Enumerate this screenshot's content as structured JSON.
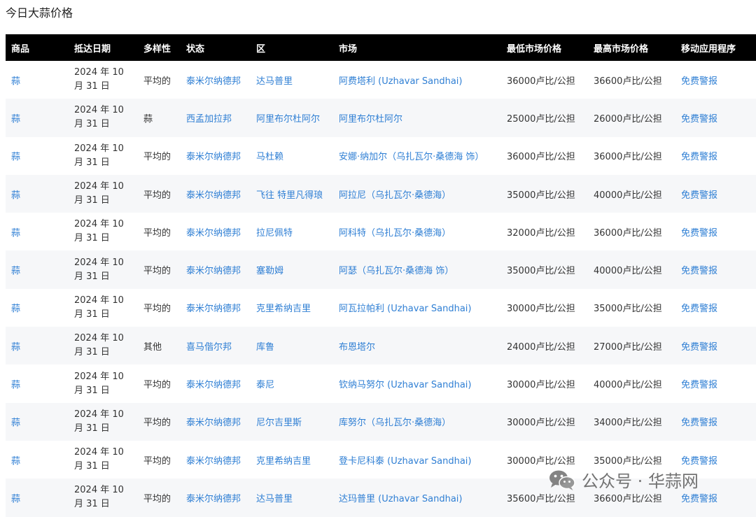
{
  "page": {
    "title": "今日大蒜价格"
  },
  "table": {
    "headers": [
      "商品",
      "抵达日期",
      "多样性",
      "状态",
      "区",
      "市场",
      "最低市场价格",
      "最高市场价格",
      "移动应用程序"
    ],
    "rows": [
      [
        "蒜",
        "2024 年 10 月 31 日",
        "平均的",
        "泰米尔纳德邦",
        "达马普里",
        "阿费塔利 (Uzhavar Sandhai)",
        "36000卢比/公担",
        "36600卢比/公担",
        "免费警报"
      ],
      [
        "蒜",
        "2024 年 10 月 31 日",
        "蒜",
        "西孟加拉邦",
        "阿里布尔杜阿尔",
        "阿里布尔杜阿尔",
        "25000卢比/公担",
        "26000卢比/公担",
        "免费警报"
      ],
      [
        "蒜",
        "2024 年 10 月 31 日",
        "平均的",
        "泰米尔纳德邦",
        "马杜赖",
        "安娜·纳加尔（乌扎瓦尔·桑德海 饰）",
        "36000卢比/公担",
        "36000卢比/公担",
        "免费警报"
      ],
      [
        "蒜",
        "2024 年 10 月 31 日",
        "平均的",
        "泰米尔纳德邦",
        "飞往 特里凡得琅",
        "阿拉尼（乌扎瓦尔·桑德海）",
        "35000卢比/公担",
        "40000卢比/公担",
        "免费警报"
      ],
      [
        "蒜",
        "2024 年 10 月 31 日",
        "平均的",
        "泰米尔纳德邦",
        "拉尼佩特",
        "阿科特（乌扎瓦尔·桑德海）",
        "32000卢比/公担",
        "36000卢比/公担",
        "免费警报"
      ],
      [
        "蒜",
        "2024 年 10 月 31 日",
        "平均的",
        "泰米尔纳德邦",
        "塞勒姆",
        "阿瑟（乌扎瓦尔·桑德海 饰）",
        "35000卢比/公担",
        "40000卢比/公担",
        "免费警报"
      ],
      [
        "蒜",
        "2024 年 10 月 31 日",
        "平均的",
        "泰米尔纳德邦",
        "克里希纳吉里",
        "阿瓦拉帕利 (Uzhavar Sandhai)",
        "30000卢比/公担",
        "35000卢比/公担",
        "免费警报"
      ],
      [
        "蒜",
        "2024 年 10 月 31 日",
        "其他",
        "喜马偕尔邦",
        "库鲁",
        "布恩塔尔",
        "24000卢比/公担",
        "27000卢比/公担",
        "免费警报"
      ],
      [
        "蒜",
        "2024 年 10 月 31 日",
        "平均的",
        "泰米尔纳德邦",
        "泰尼",
        "钦纳马努尔 (Uzhavar Sandhai)",
        "30000卢比/公担",
        "40000卢比/公担",
        "免费警报"
      ],
      [
        "蒜",
        "2024 年 10 月 31 日",
        "平均的",
        "泰米尔纳德邦",
        "尼尔吉里斯",
        "库努尔（乌扎瓦尔·桑德海）",
        "30000卢比/公担",
        "34000卢比/公担",
        "免费警报"
      ],
      [
        "蒜",
        "2024 年 10 月 31 日",
        "平均的",
        "泰米尔纳德邦",
        "克里希纳吉里",
        "登卡尼科泰 (Uzhavar Sandhai)",
        "30000卢比/公担",
        "35000卢比/公担",
        "免费警报"
      ],
      [
        "蒜",
        "2024 年 10 月 31 日",
        "平均的",
        "泰米尔纳德邦",
        "达马普里",
        "达玛普里 (Uzhavar Sandhai)",
        "35600卢比/公担",
        "36600卢比/公担",
        "免费警报"
      ]
    ]
  },
  "watermark": {
    "text": "公众号 · 华蒜网",
    "icon": "wechat-icon"
  },
  "colors": {
    "header_bg": "#000000",
    "link": "#2f7fd4",
    "stripe": "#f6f7f9"
  }
}
